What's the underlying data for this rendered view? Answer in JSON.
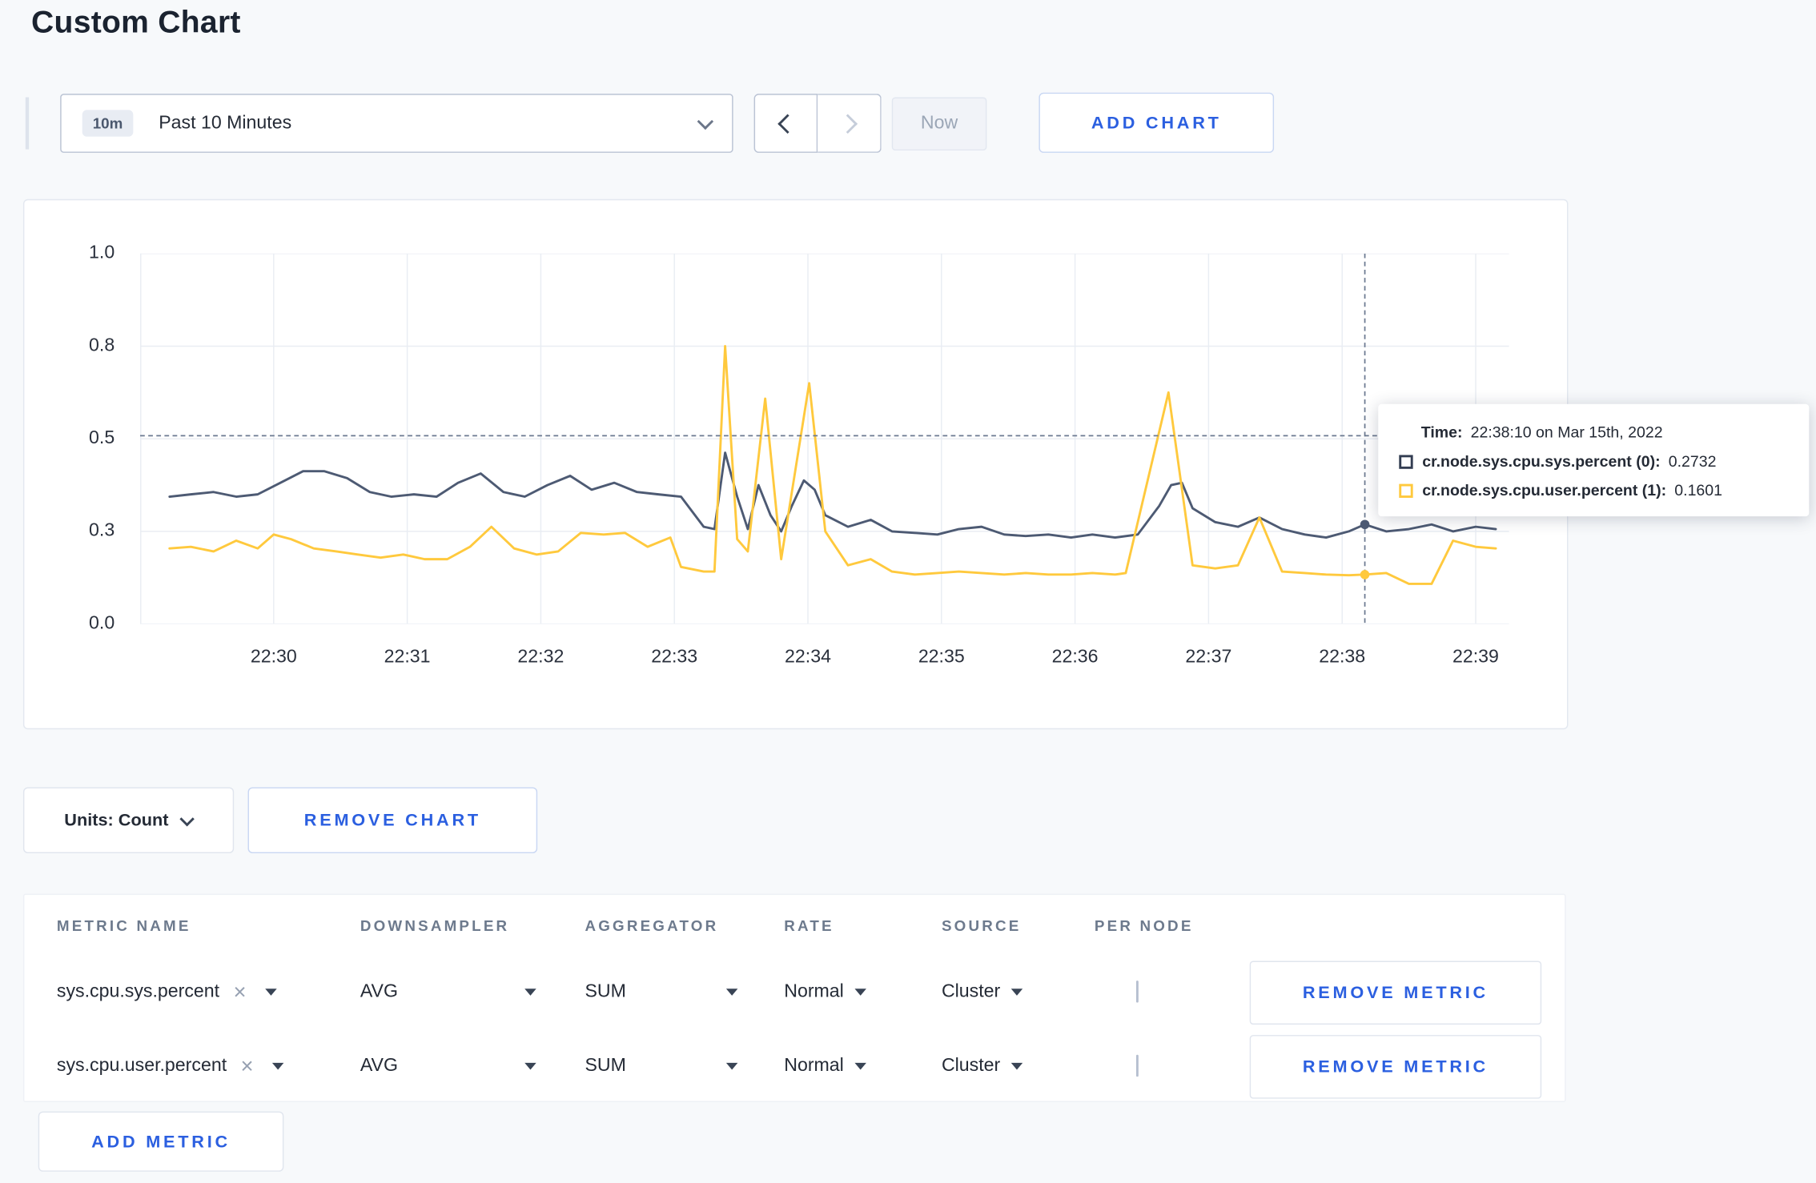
{
  "page": {
    "title": "Custom Chart"
  },
  "toolbar": {
    "time_badge": "10m",
    "time_label": "Past 10 Minutes",
    "now_label": "Now",
    "add_chart_label": "ADD CHART"
  },
  "chart_data": {
    "type": "line",
    "x_domain": [
      0,
      10.25
    ],
    "ylim": [
      0,
      1
    ],
    "grid": true,
    "legend_position": "none",
    "y_ticks": [
      {
        "value": 0.0,
        "label": "0.0"
      },
      {
        "value": 0.3,
        "label": "0.3"
      },
      {
        "value": 0.5,
        "label": "0.5"
      },
      {
        "value": 0.8,
        "label": "0.8"
      },
      {
        "value": 1.0,
        "label": "1.0"
      }
    ],
    "x_ticks": [
      {
        "t": 1,
        "label": "22:30"
      },
      {
        "t": 2,
        "label": "22:31"
      },
      {
        "t": 3,
        "label": "22:32"
      },
      {
        "t": 4,
        "label": "22:33"
      },
      {
        "t": 5,
        "label": "22:34"
      },
      {
        "t": 6,
        "label": "22:35"
      },
      {
        "t": 7,
        "label": "22:36"
      },
      {
        "t": 8,
        "label": "22:37"
      },
      {
        "t": 9,
        "label": "22:38"
      },
      {
        "t": 10,
        "label": "22:39"
      }
    ],
    "colors": {
      "grid": "#e9edf3",
      "axis": "#e9edf3",
      "crosshair": "#6b7990"
    },
    "crosshair": {
      "x_t": 9.17,
      "y_value": 0.51
    },
    "series": [
      {
        "name": "cr.node.sys.cpu.sys.percent",
        "color": "#4d5a73",
        "points": [
          [
            0.22,
            0.375
          ],
          [
            0.38,
            0.38
          ],
          [
            0.55,
            0.385
          ],
          [
            0.72,
            0.375
          ],
          [
            0.88,
            0.38
          ],
          [
            1.05,
            0.405
          ],
          [
            1.22,
            0.43
          ],
          [
            1.38,
            0.43
          ],
          [
            1.55,
            0.415
          ],
          [
            1.72,
            0.385
          ],
          [
            1.88,
            0.375
          ],
          [
            2.05,
            0.38
          ],
          [
            2.22,
            0.375
          ],
          [
            2.38,
            0.405
          ],
          [
            2.55,
            0.425
          ],
          [
            2.72,
            0.385
          ],
          [
            2.88,
            0.375
          ],
          [
            3.05,
            0.4
          ],
          [
            3.22,
            0.42
          ],
          [
            3.38,
            0.39
          ],
          [
            3.55,
            0.405
          ],
          [
            3.72,
            0.385
          ],
          [
            3.88,
            0.38
          ],
          [
            4.05,
            0.375
          ],
          [
            4.22,
            0.31
          ],
          [
            4.3,
            0.305
          ],
          [
            4.38,
            0.47
          ],
          [
            4.47,
            0.375
          ],
          [
            4.55,
            0.305
          ],
          [
            4.63,
            0.4
          ],
          [
            4.72,
            0.335
          ],
          [
            4.8,
            0.3
          ],
          [
            4.88,
            0.355
          ],
          [
            4.97,
            0.41
          ],
          [
            5.05,
            0.39
          ],
          [
            5.13,
            0.335
          ],
          [
            5.3,
            0.31
          ],
          [
            5.47,
            0.325
          ],
          [
            5.63,
            0.3
          ],
          [
            5.8,
            0.295
          ],
          [
            5.97,
            0.29
          ],
          [
            6.13,
            0.305
          ],
          [
            6.3,
            0.31
          ],
          [
            6.47,
            0.29
          ],
          [
            6.63,
            0.285
          ],
          [
            6.8,
            0.29
          ],
          [
            6.97,
            0.28
          ],
          [
            7.13,
            0.29
          ],
          [
            7.3,
            0.28
          ],
          [
            7.47,
            0.29
          ],
          [
            7.63,
            0.355
          ],
          [
            7.72,
            0.4
          ],
          [
            7.8,
            0.405
          ],
          [
            7.88,
            0.35
          ],
          [
            8.05,
            0.32
          ],
          [
            8.22,
            0.31
          ],
          [
            8.38,
            0.33
          ],
          [
            8.55,
            0.305
          ],
          [
            8.72,
            0.29
          ],
          [
            8.88,
            0.28
          ],
          [
            9.05,
            0.3
          ],
          [
            9.17,
            0.315
          ],
          [
            9.33,
            0.3
          ],
          [
            9.5,
            0.305
          ],
          [
            9.67,
            0.315
          ],
          [
            9.83,
            0.3
          ],
          [
            10.0,
            0.31
          ],
          [
            10.15,
            0.305
          ]
        ]
      },
      {
        "name": "cr.node.sys.cpu.user.percent",
        "color": "#ffc93d",
        "points": [
          [
            0.22,
            0.245
          ],
          [
            0.38,
            0.25
          ],
          [
            0.55,
            0.235
          ],
          [
            0.72,
            0.27
          ],
          [
            0.88,
            0.245
          ],
          [
            1.0,
            0.29
          ],
          [
            1.13,
            0.275
          ],
          [
            1.3,
            0.245
          ],
          [
            1.47,
            0.235
          ],
          [
            1.63,
            0.225
          ],
          [
            1.8,
            0.215
          ],
          [
            1.97,
            0.225
          ],
          [
            2.13,
            0.21
          ],
          [
            2.3,
            0.21
          ],
          [
            2.47,
            0.25
          ],
          [
            2.63,
            0.31
          ],
          [
            2.8,
            0.245
          ],
          [
            2.97,
            0.225
          ],
          [
            3.13,
            0.235
          ],
          [
            3.3,
            0.295
          ],
          [
            3.47,
            0.29
          ],
          [
            3.63,
            0.295
          ],
          [
            3.8,
            0.25
          ],
          [
            3.97,
            0.28
          ],
          [
            4.05,
            0.185
          ],
          [
            4.22,
            0.17
          ],
          [
            4.3,
            0.17
          ],
          [
            4.38,
            0.8
          ],
          [
            4.47,
            0.275
          ],
          [
            4.55,
            0.235
          ],
          [
            4.68,
            0.63
          ],
          [
            4.8,
            0.21
          ],
          [
            5.01,
            0.68
          ],
          [
            5.13,
            0.3
          ],
          [
            5.3,
            0.19
          ],
          [
            5.47,
            0.21
          ],
          [
            5.63,
            0.17
          ],
          [
            5.8,
            0.16
          ],
          [
            5.97,
            0.165
          ],
          [
            6.13,
            0.17
          ],
          [
            6.3,
            0.165
          ],
          [
            6.47,
            0.16
          ],
          [
            6.63,
            0.165
          ],
          [
            6.8,
            0.16
          ],
          [
            6.97,
            0.16
          ],
          [
            7.13,
            0.165
          ],
          [
            7.3,
            0.16
          ],
          [
            7.38,
            0.165
          ],
          [
            7.7,
            0.65
          ],
          [
            7.88,
            0.19
          ],
          [
            8.05,
            0.18
          ],
          [
            8.22,
            0.19
          ],
          [
            8.38,
            0.33
          ],
          [
            8.55,
            0.17
          ],
          [
            8.72,
            0.165
          ],
          [
            8.88,
            0.16
          ],
          [
            9.05,
            0.158
          ],
          [
            9.17,
            0.16
          ],
          [
            9.33,
            0.165
          ],
          [
            9.5,
            0.13
          ],
          [
            9.67,
            0.13
          ],
          [
            9.83,
            0.27
          ],
          [
            10.0,
            0.25
          ],
          [
            10.15,
            0.245
          ]
        ]
      }
    ]
  },
  "tooltip": {
    "time_label": "Time:",
    "time_value": "22:38:10 on Mar 15th, 2022",
    "entries": [
      {
        "label": "cr.node.sys.cpu.sys.percent (0):",
        "value": "0.2732",
        "color": "#333d52"
      },
      {
        "label": "cr.node.sys.cpu.user.percent (1):",
        "value": "0.1601",
        "color": "#ffc93d"
      }
    ]
  },
  "chart_footer": {
    "units_label": "Units: Count",
    "remove_chart_label": "REMOVE CHART"
  },
  "metrics_table": {
    "headers": [
      "METRIC NAME",
      "DOWNSAMPLER",
      "AGGREGATOR",
      "RATE",
      "SOURCE",
      "PER NODE"
    ],
    "clear_icon": "×",
    "rows": [
      {
        "metric": "sys.cpu.sys.percent",
        "downsampler": "AVG",
        "aggregator": "SUM",
        "rate": "Normal",
        "source": "Cluster",
        "per_node_checked": false,
        "remove_label": "REMOVE METRIC"
      },
      {
        "metric": "sys.cpu.user.percent",
        "downsampler": "AVG",
        "aggregator": "SUM",
        "rate": "Normal",
        "source": "Cluster",
        "per_node_checked": false,
        "remove_label": "REMOVE METRIC"
      }
    ],
    "add_metric_label": "ADD METRIC"
  },
  "colors": {
    "accent": "#2b5fe0",
    "text": "#242a35",
    "muted": "#6d7a8d",
    "background": "#f7f9fb"
  }
}
